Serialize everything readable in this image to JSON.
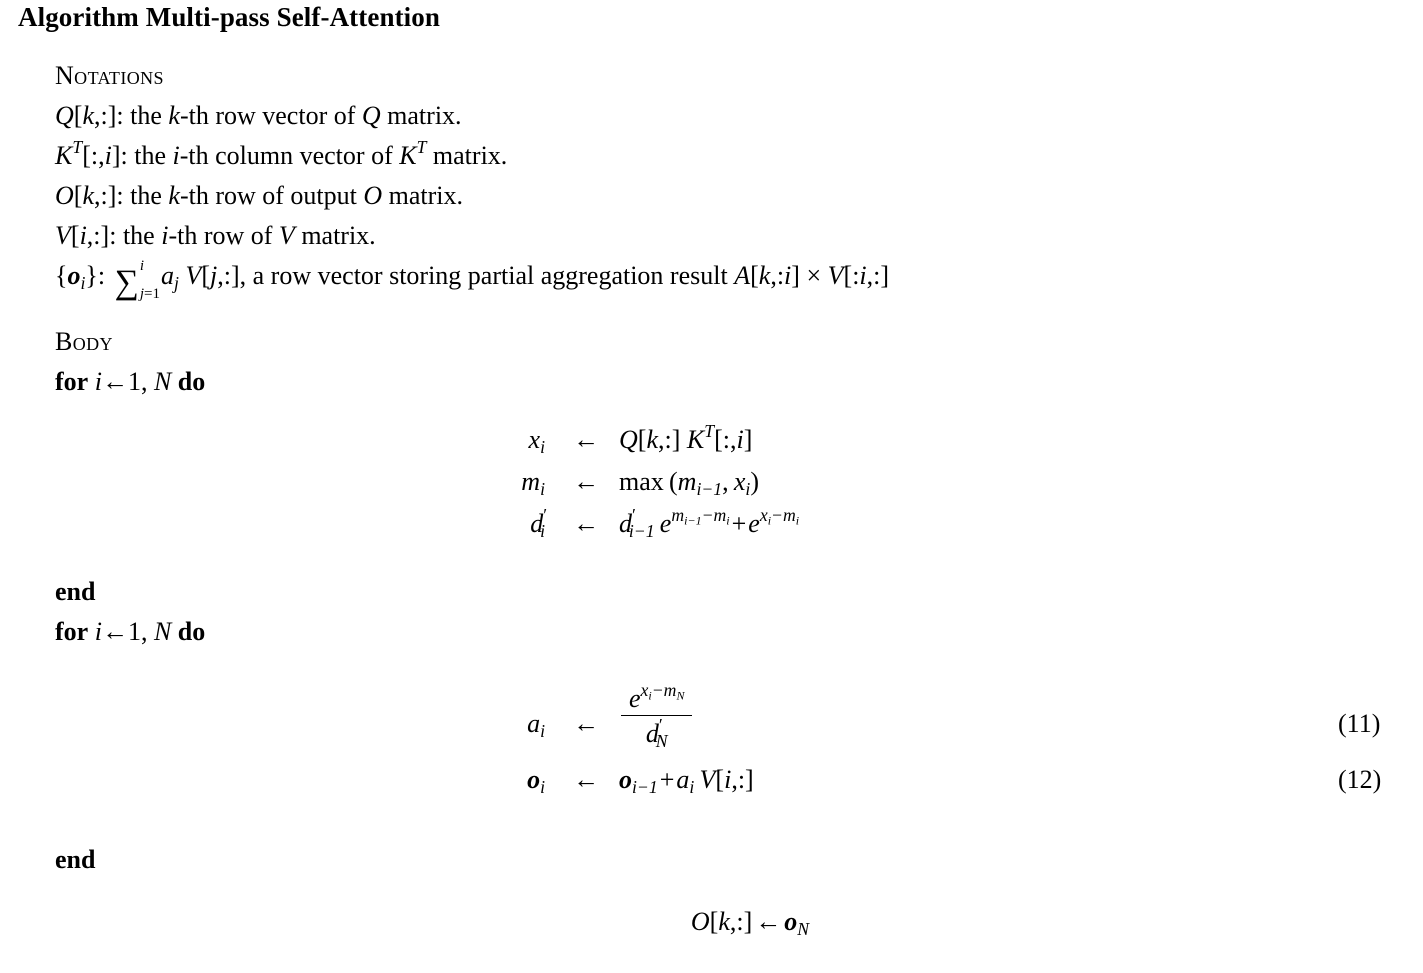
{
  "title": "Algorithm Multi-pass Self-Attention",
  "sections": {
    "notations_heading": "Notations",
    "body_heading": "Body"
  },
  "notations": [
    {
      "id": "q-row",
      "symbol": "Q[k,:]",
      "text": ": the k-th row vector of Q matrix."
    },
    {
      "id": "kt-col",
      "symbol": "K^T[:,i]",
      "text": ": the i-th column vector of K^T matrix."
    },
    {
      "id": "o-row",
      "symbol": "O[k,:]",
      "text": ": the k-th row of output O matrix."
    },
    {
      "id": "v-row",
      "symbol": "V[i,:]",
      "text": ": the i-th row of V matrix."
    },
    {
      "id": "partial-agg",
      "symbol": "{o_i}",
      "text": ": sum_{j=1}^{i} a_j V[j,:], a row vector storing partial aggregation result A[k,:i] x V[:i,:]"
    }
  ],
  "notation_fragments": {
    "the": "the",
    "th_row_vector_of": "-th row vector of",
    "th_column_vector_of": "-th column vector of",
    "th_row_of_output": "-th row of output",
    "th_row_of": "-th row of",
    "matrix_period": "matrix.",
    "a_row_vector_storing": ", a row vector storing partial aggregation result"
  },
  "loops": {
    "for_keyword": "for",
    "do_keyword": "do",
    "end_keyword": "end",
    "loop_start": "1",
    "loop_end": "N",
    "first_loop_label": "for i <- 1, N do",
    "second_loop_label": "for i <- 1, N do"
  },
  "equations": [
    {
      "id": "eq-x",
      "lhs": "x_i",
      "arrow": "<-",
      "rhs": "Q[k,:] K^T[:,i]",
      "number": ""
    },
    {
      "id": "eq-m",
      "lhs": "m_i",
      "arrow": "<-",
      "rhs": "max (m_{i-1}, x_i)",
      "number": ""
    },
    {
      "id": "eq-d",
      "lhs": "d'_i",
      "arrow": "<-",
      "rhs": "d'_{i-1} e^{m_{i-1} - m_i} + e^{x_i - m_i}",
      "number": ""
    },
    {
      "id": "eq-a",
      "lhs": "a_i",
      "arrow": "<-",
      "rhs": "e^{x_i - m_N} / d'_N",
      "number": "(11)"
    },
    {
      "id": "eq-o",
      "lhs": "o_i",
      "arrow": "<-",
      "rhs": "o_{i-1} + a_i V[i,:]",
      "number": "(12)"
    }
  ],
  "output_line": {
    "text": "O[k,:] <- o_N"
  },
  "symbols": {
    "arrow_left": "←",
    "sum": "∑",
    "times": "×",
    "max": "max",
    "e": "e",
    "plus": "+",
    "minus": "−",
    "comma": ",",
    "colon": ":",
    "prime": "′",
    "bracket_open": "[",
    "bracket_close": "]",
    "brace_open": "{",
    "brace_close": "}",
    "paren_open": "(",
    "paren_close": ")",
    "one": "1",
    "eq": "=",
    "var_i": "i",
    "var_j": "j",
    "var_k": "k",
    "var_N": "N",
    "var_Q": "Q",
    "var_K": "K",
    "var_O": "O",
    "var_V": "V",
    "var_A": "A",
    "var_T": "T",
    "var_a": "a",
    "var_d": "d",
    "var_m": "m",
    "var_x": "x",
    "var_o": "o"
  },
  "colors": {
    "background": "#ffffff",
    "text": "#000000"
  }
}
